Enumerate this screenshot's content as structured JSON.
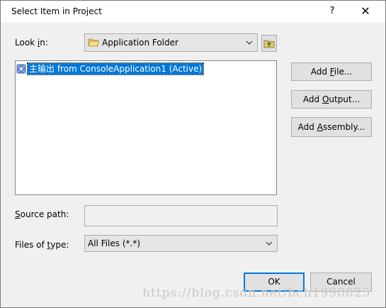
{
  "window": {
    "title": "Select Item in Project",
    "help_label": "?",
    "close_label": "✕"
  },
  "look_in": {
    "label_pre": "Look ",
    "label_accel": "i",
    "label_post": "n:",
    "selected_value": "Application Folder"
  },
  "list": {
    "items": [
      {
        "label": "主输出 from ConsoleApplication1 (Active)",
        "selected": true
      }
    ]
  },
  "buttons": {
    "add_file": {
      "pre": "Add ",
      "accel": "F",
      "post": "ile..."
    },
    "add_output": {
      "pre": "Add ",
      "accel": "O",
      "post": "utput..."
    },
    "add_assembly": {
      "pre": "Add ",
      "accel": "A",
      "post": "ssembly..."
    },
    "ok": "OK",
    "cancel": "Cancel"
  },
  "source_path": {
    "label_accel": "S",
    "label_post": "ource path:",
    "value": ""
  },
  "files_of_type": {
    "label_pre": "Files of ",
    "label_accel": "t",
    "label_post": "ype:",
    "selected_value": "All Files (*.*)"
  },
  "watermark": "https://blog.csdn.net/bch1990825",
  "colors": {
    "selection": "#0078d7",
    "dialog_bg": "#f0f0f0"
  }
}
